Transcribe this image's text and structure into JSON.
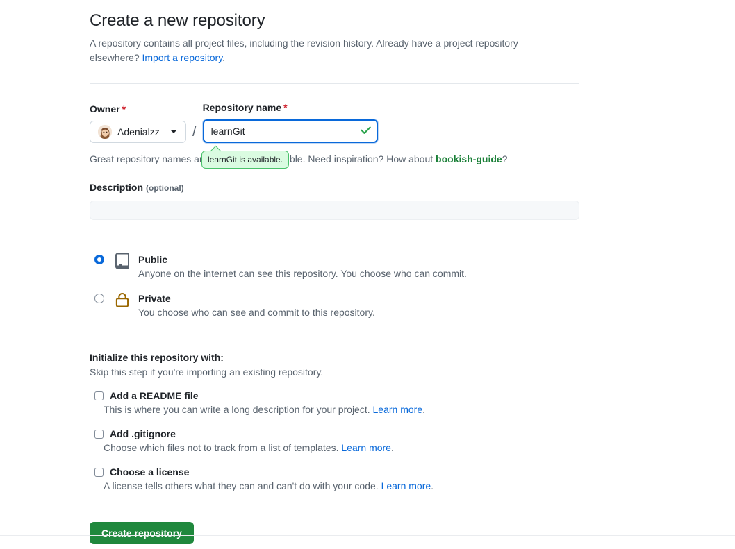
{
  "header": {
    "title": "Create a new repository",
    "subtitle_part1": "A repository contains all project files, including the revision history. Already have a project repository elsewhere? ",
    "import_link": "Import a repository",
    "subtitle_part2": "."
  },
  "owner": {
    "label": "Owner",
    "required_mark": "*",
    "name": "Adenialzz",
    "avatar_alt": "user-avatar"
  },
  "separator": "/",
  "repo_name": {
    "label": "Repository name",
    "required_mark": "*",
    "value": "learnGit",
    "placeholder": "",
    "valid_icon": "check-icon"
  },
  "availability": {
    "prefix": "Great repository names are short and memorable. Need inspiration? How about ",
    "suggestion": "bookish-guide",
    "suffix": "?",
    "tooltip": "learnGit is available."
  },
  "description": {
    "label": "Description",
    "optional": "(optional)",
    "value": "",
    "placeholder": ""
  },
  "visibility": {
    "options": [
      {
        "id": "public",
        "title": "Public",
        "desc": "Anyone on the internet can see this repository. You choose who can commit.",
        "icon": "repo-icon",
        "selected": true
      },
      {
        "id": "private",
        "title": "Private",
        "desc": "You choose who can see and commit to this repository.",
        "icon": "lock-icon",
        "selected": false
      }
    ]
  },
  "initialize": {
    "title": "Initialize this repository with:",
    "subtitle": "Skip this step if you're importing an existing repository.",
    "items": [
      {
        "id": "readme",
        "label": "Add a README file",
        "desc": "This is where you can write a long description for your project. ",
        "link": "Learn more",
        "link_suffix": ".",
        "checked": false
      },
      {
        "id": "gitignore",
        "label": "Add .gitignore",
        "desc": "Choose which files not to track from a list of templates. ",
        "link": "Learn more",
        "link_suffix": ".",
        "checked": false
      },
      {
        "id": "license",
        "label": "Choose a license",
        "desc": "A license tells others what they can and can't do with your code. ",
        "link": "Learn more",
        "link_suffix": ".",
        "checked": false
      }
    ]
  },
  "submit": {
    "label": "Create repository"
  },
  "colors": {
    "accent_blue": "#0969da",
    "success_green": "#1f883d",
    "suggestion_green": "#1a7f37",
    "tooltip_bg": "#dafbe1",
    "tooltip_border": "#4ac26b",
    "required_red": "#cf222e",
    "lock_gold": "#9a6700",
    "muted_text": "#59636e"
  }
}
